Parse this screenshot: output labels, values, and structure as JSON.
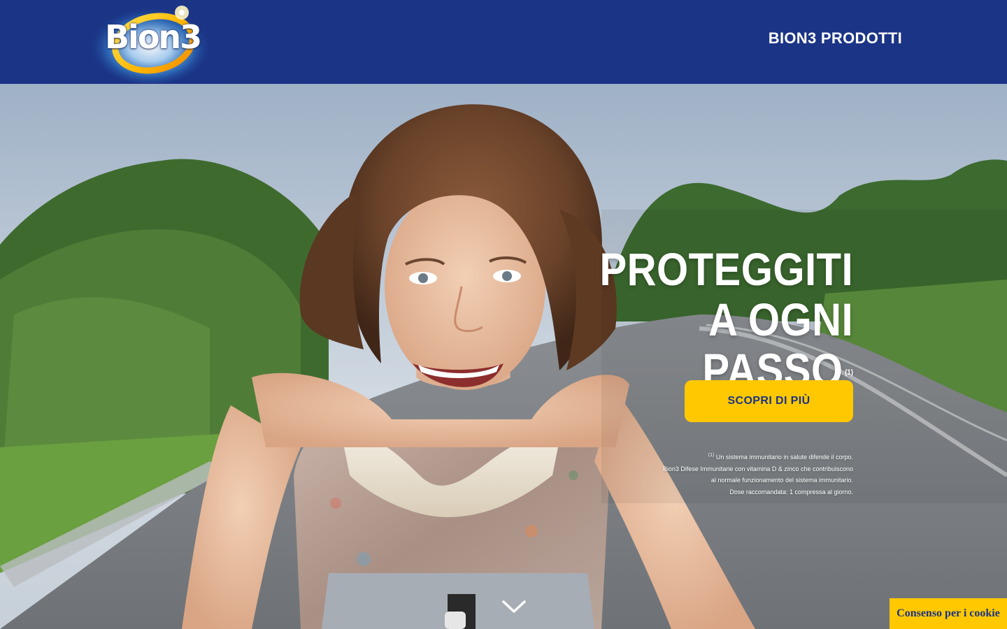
{
  "header": {
    "logo_text": "Bion3",
    "nav_products_label": "BION3 PRODOTTI"
  },
  "hero": {
    "headline_line1": "PROTEGGITI",
    "headline_line2": "A OGNI",
    "headline_line3": "PASSO",
    "headline_footnote_mark": "(1)",
    "cta_label": "SCOPRI DI PIÙ",
    "footnote_mark": "(1)",
    "footnote_line1": "Un sistema immunitario in salute difende il corpo.",
    "footnote_line2": "Bion3 Difese Immunitarie con vitamina D & zinco che contribuiscono",
    "footnote_line3": "al normale funzionamento del sistema immunitario.",
    "footnote_line4": "Dose raccomandata: 1 compressa al giorno.",
    "scroll_icon": "chevron-down-icon"
  },
  "cookie": {
    "label": "Consenso per i cookie"
  },
  "colors": {
    "brand_blue": "#1b3486",
    "accent_yellow": "#ffc800",
    "white": "#ffffff"
  }
}
